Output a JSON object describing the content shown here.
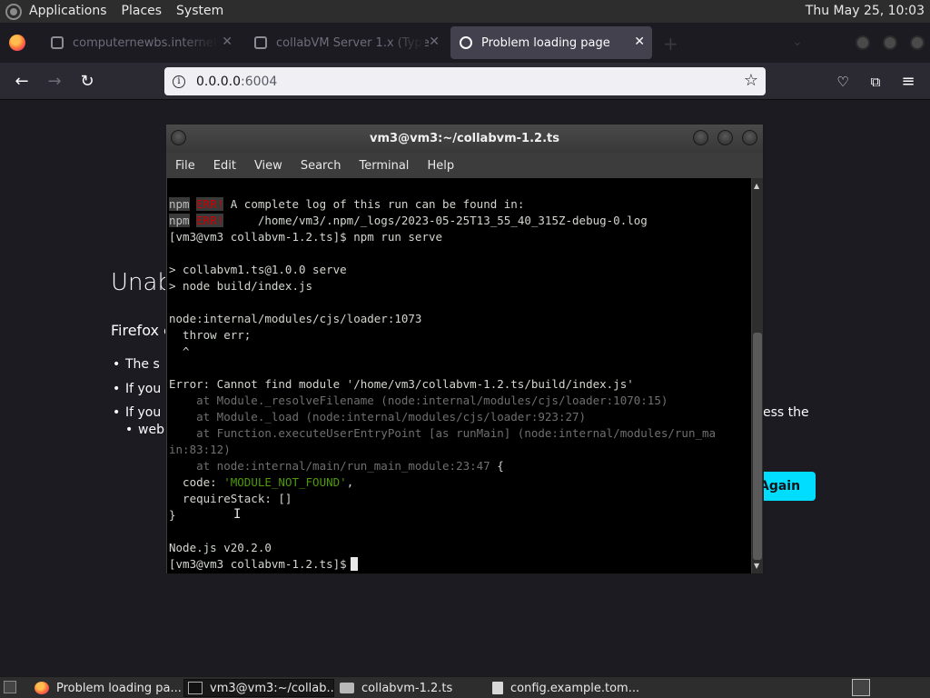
{
  "top_panel": {
    "menus": [
      "Applications",
      "Places",
      "System"
    ],
    "clock": "Thu May 25, 10:03"
  },
  "browser": {
    "tabs": [
      {
        "label": "computernewbs.internet",
        "active": false
      },
      {
        "label": "collabVM Server 1.x (Type",
        "active": false
      },
      {
        "label": "Problem loading page",
        "active": true
      }
    ],
    "url": {
      "host": "0.0.0.0",
      "port": ":6004"
    },
    "page": {
      "title": "Unab",
      "lead": "Firefox c",
      "bullets": [
        "The s",
        "If you",
        "If you",
        "web"
      ],
      "bullet_tail": "ess the",
      "button": "Again"
    }
  },
  "terminal": {
    "title": "vm3@vm3:~/collabvm-1.2.ts",
    "menus": [
      "File",
      "Edit",
      "View",
      "Search",
      "Terminal",
      "Help"
    ],
    "lines": {
      "l1_npm": "npm",
      "l1_err": "ERR!",
      "l1_text": " A complete log of this run can be found in:",
      "l2_npm": "npm",
      "l2_err": "ERR!",
      "l2_text": "     /home/vm3/.npm/_logs/2023-05-25T13_55_40_315Z-debug-0.log",
      "l3": "[vm3@vm3 collabvm-1.2.ts]$ npm run serve",
      "l5": "> collabvm1.ts@1.0.0 serve",
      "l6": "> node build/index.js",
      "l8": "node:internal/modules/cjs/loader:1073",
      "l9": "  throw err;",
      "l10": "  ^",
      "l12": "Error: Cannot find module '/home/vm3/collabvm-1.2.ts/build/index.js'",
      "l13": "    at Module._resolveFilename (node:internal/modules/cjs/loader:1070:15)",
      "l14": "    at Module._load (node:internal/modules/cjs/loader:923:27)",
      "l15": "    at Function.executeUserEntryPoint [as runMain] (node:internal/modules/run_ma",
      "l16": "in:83:12)",
      "l17a": "    at node:internal/main/run_main_module:23:47",
      "l17b": " {",
      "l18a": "  code: ",
      "l18b": "'MODULE_NOT_FOUND'",
      "l18c": ",",
      "l19": "  requireStack: []",
      "l20": "}",
      "l22": "Node.js v20.2.0",
      "l23": "[vm3@vm3 collabvm-1.2.ts]$"
    }
  },
  "taskbar": {
    "items": [
      {
        "label": "Problem loading pa...",
        "icon": "firefox-icon"
      },
      {
        "label": "vm3@vm3:~/collab...",
        "icon": "terminal-icon"
      },
      {
        "label": "collabvm-1.2.ts",
        "icon": "folder-icon"
      },
      {
        "label": "config.example.tom...",
        "icon": "text-editor-icon"
      }
    ]
  }
}
